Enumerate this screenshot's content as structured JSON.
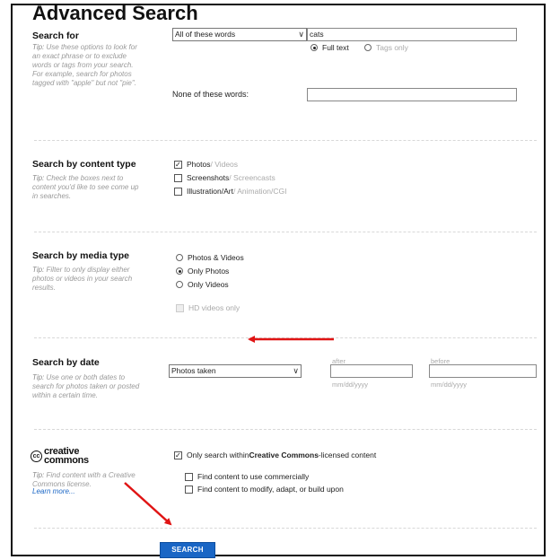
{
  "page": {
    "title": "Advanced Search"
  },
  "search_for": {
    "title": "Search for",
    "tip_label": "Tip:",
    "tip": "Use these options to look for an exact phrase or to exclude words or tags from your search. For example, search for photos tagged with \"apple\" but not \"pie\".",
    "mode_select": "All of these words",
    "query_value": "cats",
    "radio_full_text": "Full text",
    "radio_tags_only": "Tags only",
    "none_label": "None of these words:",
    "none_value": ""
  },
  "content_type": {
    "title": "Search by content type",
    "tip_label": "Tip:",
    "tip": "Check the boxes next to content you'd like to see come up in searches.",
    "items": [
      {
        "main": "Photos",
        "sub": " / Videos",
        "checked": true
      },
      {
        "main": "Screenshots",
        "sub": " / Screencasts",
        "checked": false
      },
      {
        "main": "Illustration/Art",
        "sub": " / Animation/CGI",
        "checked": false
      }
    ]
  },
  "media_type": {
    "title": "Search by media type",
    "tip_label": "Tip:",
    "tip": "Filter to only display either photos or videos in your search results.",
    "options": [
      "Photos & Videos",
      "Only Photos",
      "Only Videos"
    ],
    "hd_label": "HD videos only"
  },
  "date": {
    "title": "Search by date",
    "tip_label": "Tip:",
    "tip": "Use one or both dates to search for photos taken or posted within a certain time.",
    "select_value": "Photos taken",
    "after_label": "after",
    "before_label": "before",
    "after_placeholder": "mm/dd/yyyy",
    "before_placeholder": "mm/dd/yyyy"
  },
  "creative_commons": {
    "logo_line1": "creative",
    "logo_line2": "commons",
    "logo_mark": "cc",
    "tip_label": "Tip:",
    "tip": "Find content with a Creative Commons license.",
    "learn_more": "Learn more...",
    "only_prefix": "Only search within ",
    "only_bold": "Creative Commons",
    "only_suffix": "-licensed content",
    "commercial": "Find content to use commercially",
    "modify": "Find content to modify, adapt, or build upon"
  },
  "search_button": "SEARCH",
  "colors": {
    "arrow": "#e01414",
    "button": "#1a66c5"
  }
}
